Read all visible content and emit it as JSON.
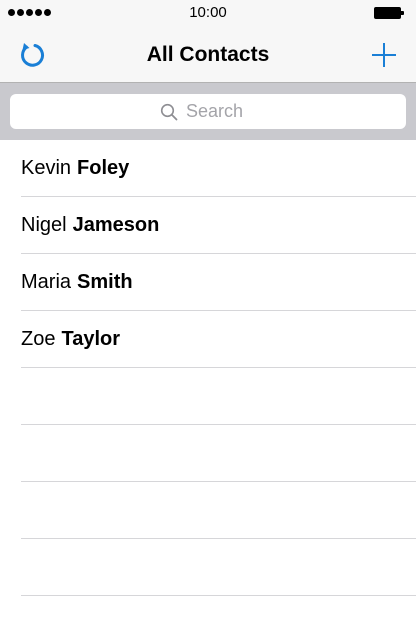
{
  "status_bar": {
    "time": "10:00"
  },
  "nav_bar": {
    "title": "All Contacts",
    "left_icon": "refresh-icon",
    "right_icon": "plus-icon",
    "accent_color": "#1a7fd6"
  },
  "search": {
    "placeholder": "Search",
    "value": ""
  },
  "contacts": [
    {
      "first_name": "Kevin",
      "last_name": "Foley"
    },
    {
      "first_name": "Nigel",
      "last_name": "Jameson"
    },
    {
      "first_name": "Maria",
      "last_name": "Smith"
    },
    {
      "first_name": "Zoe",
      "last_name": "Taylor"
    }
  ]
}
